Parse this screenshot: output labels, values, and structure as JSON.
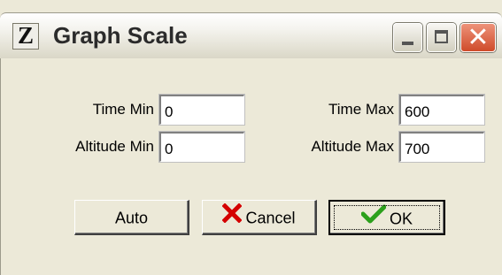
{
  "window": {
    "title": "Graph Scale",
    "app_icon_letter": "Z",
    "controls": {
      "minimize": "minimize",
      "maximize": "maximize",
      "close": "✕"
    }
  },
  "fields": {
    "time_min": {
      "label": "Time Min",
      "value": "0"
    },
    "time_max": {
      "label": "Time Max",
      "value": "600"
    },
    "altitude_min": {
      "label": "Altitude Min",
      "value": "0"
    },
    "altitude_max": {
      "label": "Altitude Max",
      "value": "700"
    }
  },
  "buttons": {
    "auto": {
      "label": "Auto"
    },
    "cancel": {
      "label": "Cancel",
      "icon": "red-x-icon",
      "icon_color": "#d40000"
    },
    "ok": {
      "label": "OK",
      "icon": "green-checkmark-icon",
      "icon_color": "#2ca01c"
    }
  }
}
